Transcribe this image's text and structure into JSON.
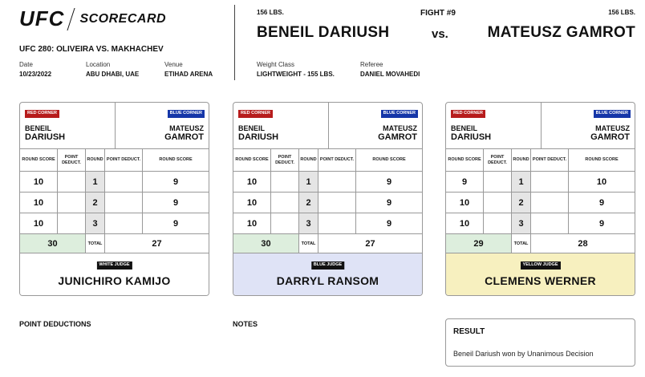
{
  "header": {
    "logo": "UFC",
    "logo_sub": "SCORECARD",
    "event_title": "UFC 280: OLIVEIRA VS. MAKHACHEV",
    "date_label": "Date",
    "date": "10/23/2022",
    "location_label": "Location",
    "location": "ABU DHABI, UAE",
    "venue_label": "Venue",
    "venue": "ETIHAD ARENA"
  },
  "fight": {
    "red_weight": "156 LBS.",
    "blue_weight": "156 LBS.",
    "fight_number": "FIGHT #9",
    "red_name": "BENEIL DARIUSH",
    "blue_name": "MATEUSZ GAMROT",
    "vs": "vs.",
    "weight_class_label": "Weight Class",
    "weight_class": "LIGHTWEIGHT - 155 LBS.",
    "referee_label": "Referee",
    "referee": "DANIEL MOVAHEDI"
  },
  "labels": {
    "red_corner": "RED CORNER",
    "blue_corner": "BLUE CORNER",
    "round_score": "ROUND SCORE",
    "point_deduct": "POINT DEDUCT.",
    "round": "ROUND",
    "total": "TOTAL",
    "red_first": "BENEIL",
    "red_last": "DARIUSH",
    "blue_first": "MATEUSZ",
    "blue_last": "GAMROT"
  },
  "cards": [
    {
      "judge_badge": "WHITE JUDGE",
      "judge_name": "JUNICHIRO KAMIJO",
      "judge_color": "#ffffff",
      "rounds": [
        {
          "red": "10",
          "red_ded": "",
          "round": "1",
          "blue_ded": "",
          "blue": "9"
        },
        {
          "red": "10",
          "red_ded": "",
          "round": "2",
          "blue_ded": "",
          "blue": "9"
        },
        {
          "red": "10",
          "red_ded": "",
          "round": "3",
          "blue_ded": "",
          "blue": "9"
        }
      ],
      "red_total": "30",
      "blue_total": "27"
    },
    {
      "judge_badge": "BLUE JUDGE",
      "judge_name": "DARRYL RANSOM",
      "judge_color": "#dfe3f6",
      "rounds": [
        {
          "red": "10",
          "red_ded": "",
          "round": "1",
          "blue_ded": "",
          "blue": "9"
        },
        {
          "red": "10",
          "red_ded": "",
          "round": "2",
          "blue_ded": "",
          "blue": "9"
        },
        {
          "red": "10",
          "red_ded": "",
          "round": "3",
          "blue_ded": "",
          "blue": "9"
        }
      ],
      "red_total": "30",
      "blue_total": "27"
    },
    {
      "judge_badge": "YELLOW JUDGE",
      "judge_name": "CLEMENS WERNER",
      "judge_color": "#f7f0bf",
      "rounds": [
        {
          "red": "9",
          "red_ded": "",
          "round": "1",
          "blue_ded": "",
          "blue": "10"
        },
        {
          "red": "10",
          "red_ded": "",
          "round": "2",
          "blue_ded": "",
          "blue": "9"
        },
        {
          "red": "10",
          "red_ded": "",
          "round": "3",
          "blue_ded": "",
          "blue": "9"
        }
      ],
      "red_total": "29",
      "blue_total": "28"
    }
  ],
  "bottom": {
    "point_deductions_title": "POINT DEDUCTIONS",
    "notes_title": "NOTES",
    "result_title": "RESULT",
    "result_text": "Beneil Dariush won by Unanimous Decision"
  }
}
